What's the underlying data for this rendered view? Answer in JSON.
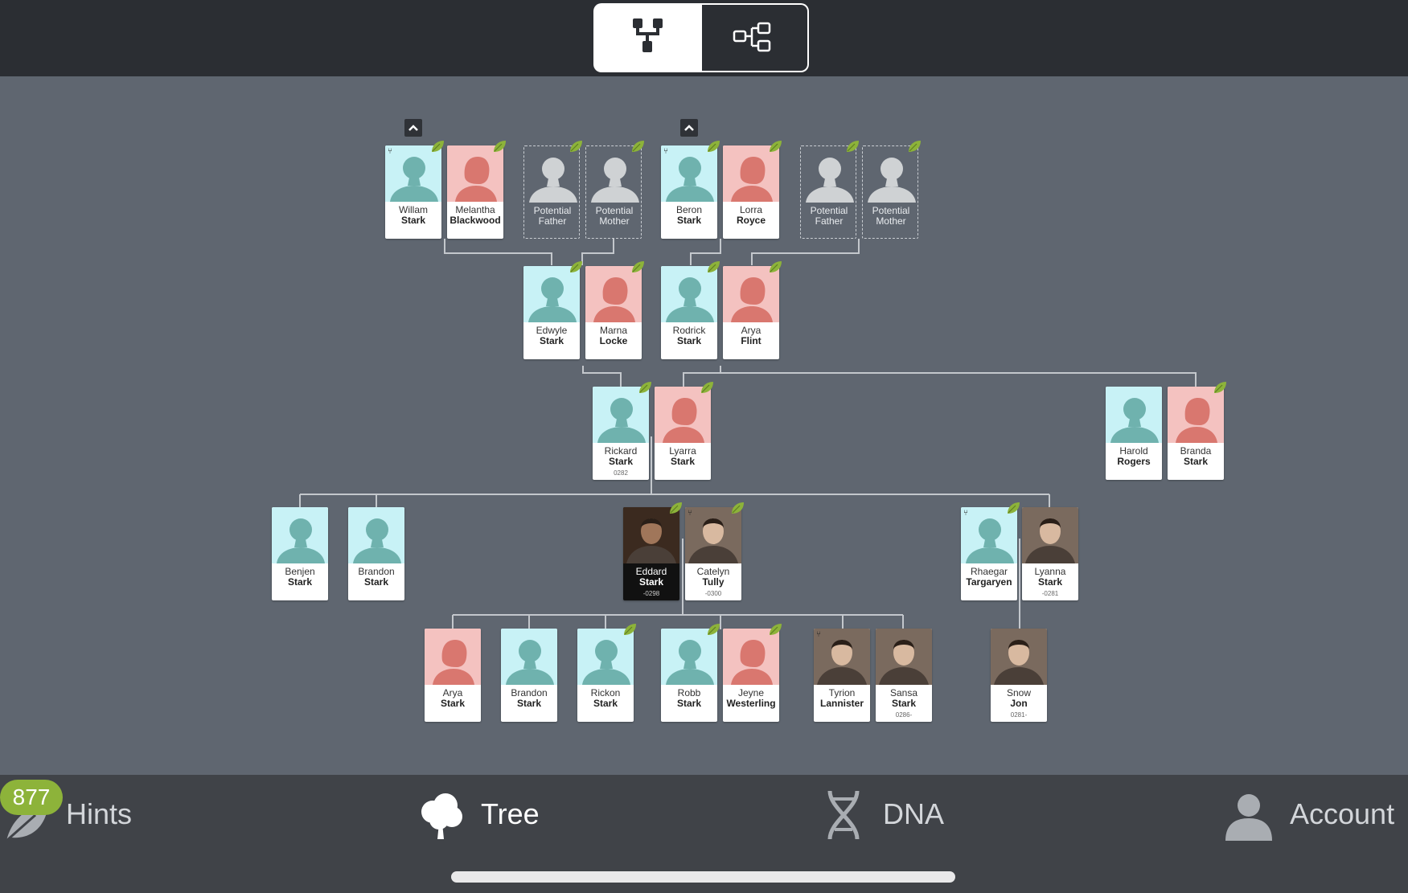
{
  "app": {
    "view_toggle": {
      "vertical_icon": "vertical-tree-icon",
      "horizontal_icon": "horizontal-tree-icon",
      "active": "vertical"
    }
  },
  "tree": {
    "row1": [
      {
        "first": "Willam",
        "last": "Stark",
        "sex": "male",
        "leaf": true,
        "tree_mark": true
      },
      {
        "first": "Melantha",
        "last": "Blackwood",
        "sex": "female",
        "leaf": true
      },
      {
        "first": "Potential",
        "last": "Father",
        "sex": "potential",
        "leaf": true
      },
      {
        "first": "Potential",
        "last": "Mother",
        "sex": "potential",
        "leaf": true
      },
      {
        "first": "Beron",
        "last": "Stark",
        "sex": "male",
        "leaf": true,
        "tree_mark": true
      },
      {
        "first": "Lorra",
        "last": "Royce",
        "sex": "female",
        "leaf": true
      },
      {
        "first": "Potential",
        "last": "Father",
        "sex": "potential",
        "leaf": true
      },
      {
        "first": "Potential",
        "last": "Mother",
        "sex": "potential",
        "leaf": true
      }
    ],
    "row2": [
      {
        "first": "Edwyle",
        "last": "Stark",
        "sex": "male",
        "leaf": true
      },
      {
        "first": "Marna",
        "last": "Locke",
        "sex": "female",
        "leaf": true
      },
      {
        "first": "Rodrick",
        "last": "Stark",
        "sex": "male",
        "leaf": true
      },
      {
        "first": "Arya",
        "last": "Flint",
        "sex": "female",
        "leaf": true
      }
    ],
    "row3": [
      {
        "first": "Rickard",
        "last": "Stark",
        "dates": "0282",
        "sex": "male",
        "leaf": true
      },
      {
        "first": "Lyarra",
        "last": "Stark",
        "sex": "female",
        "leaf": true
      },
      {
        "first": "Harold",
        "last": "Rogers",
        "sex": "male"
      },
      {
        "first": "Branda",
        "last": "Stark",
        "sex": "female",
        "leaf": true
      }
    ],
    "row4": [
      {
        "first": "Benjen",
        "last": "Stark",
        "sex": "male"
      },
      {
        "first": "Brandon",
        "last": "Stark",
        "sex": "male"
      },
      {
        "first": "Eddard",
        "last": "Stark",
        "dates": "-0298",
        "sex": "photo-dark",
        "leaf": true
      },
      {
        "first": "Catelyn",
        "last": "Tully",
        "dates": "-0300",
        "sex": "photo",
        "leaf": true,
        "tree_mark": true
      },
      {
        "first": "Rhaegar",
        "last": "Targaryen",
        "sex": "male",
        "leaf": true,
        "tree_mark": true
      },
      {
        "first": "Lyanna",
        "last": "Stark",
        "dates": "-0281",
        "sex": "photo"
      }
    ],
    "row5": [
      {
        "first": "Arya",
        "last": "Stark",
        "sex": "female"
      },
      {
        "first": "Brandon",
        "last": "Stark",
        "sex": "male"
      },
      {
        "first": "Rickon",
        "last": "Stark",
        "sex": "male",
        "leaf": true
      },
      {
        "first": "Robb",
        "last": "Stark",
        "sex": "male",
        "leaf": true
      },
      {
        "first": "Jeyne",
        "last": "Westerling",
        "sex": "female",
        "leaf": true
      },
      {
        "first": "Tyrion",
        "last": "Lannister",
        "sex": "photo",
        "tree_mark": true
      },
      {
        "first": "Sansa",
        "last": "Stark",
        "dates": "0286-",
        "sex": "photo"
      },
      {
        "first": "Snow",
        "last": "Jon",
        "dates": "0281-",
        "sex": "photo"
      }
    ]
  },
  "bottom_nav": {
    "hints": {
      "label": "Hints",
      "badge": "877",
      "icon": "leaf-icon"
    },
    "tree": {
      "label": "Tree",
      "icon": "tree-icon"
    },
    "dna": {
      "label": "DNA",
      "icon": "dna-icon"
    },
    "account": {
      "label": "Account",
      "icon": "person-icon"
    }
  },
  "colors": {
    "male": "#c8f2f6",
    "female": "#f4c2c0",
    "leaf": "#8db33a",
    "background": "#5f6670"
  }
}
